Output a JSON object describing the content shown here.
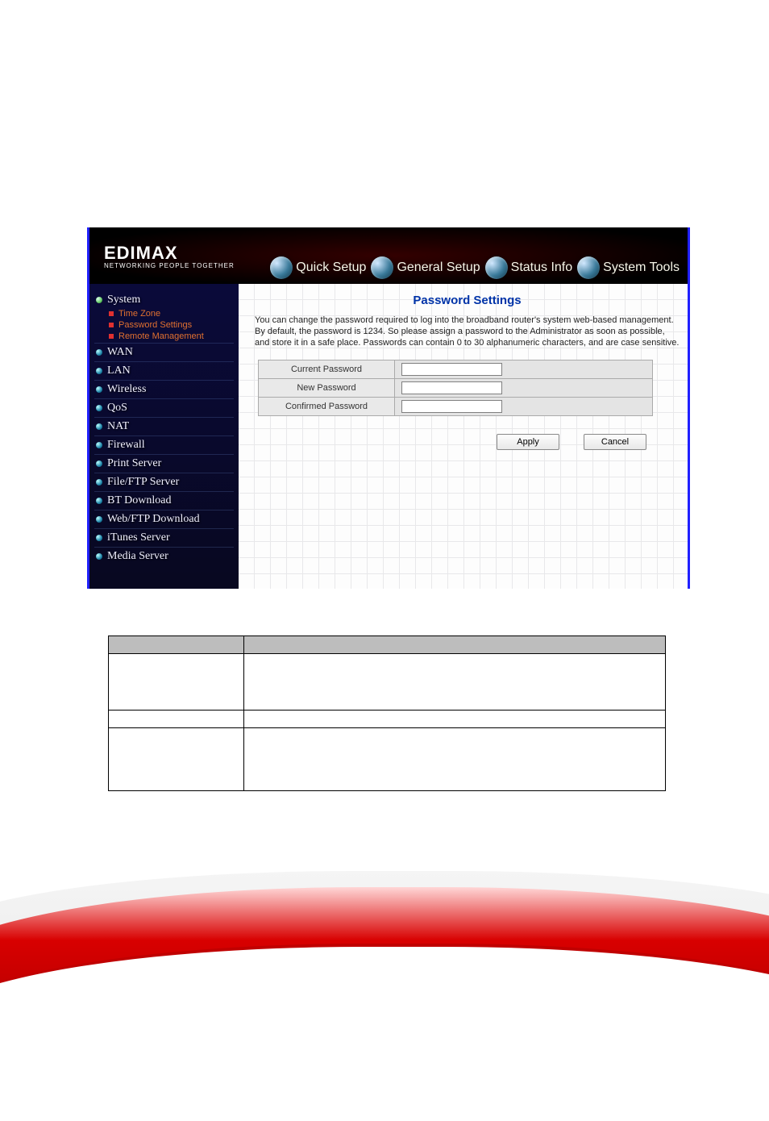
{
  "brand": {
    "name": "EDIMAX",
    "tagline": "NETWORKING PEOPLE TOGETHER"
  },
  "tabs": {
    "quick": "Quick Setup",
    "general": "General Setup",
    "status": "Status Info",
    "tools": "System Tools"
  },
  "sidebar": {
    "system": "System",
    "system_children": {
      "tz": "Time Zone",
      "pw": "Password Settings",
      "rm": "Remote Management"
    },
    "wan": "WAN",
    "lan": "LAN",
    "wireless": "Wireless",
    "qos": "QoS",
    "nat": "NAT",
    "firewall": "Firewall",
    "print": "Print Server",
    "fileftp": "File/FTP Server",
    "bt": "BT Download",
    "webftp": "Web/FTP Download",
    "itunes": "iTunes Server",
    "media": "Media Server"
  },
  "page": {
    "title": "Password Settings",
    "description": "You can change the password required to log into the broadband router's system web-based management. By default, the password is 1234. So please assign a password to the Administrator as soon as possible, and store it in a safe place. Passwords can contain 0 to 30 alphanumeric characters, and are case sensitive.",
    "fields": {
      "current": {
        "label": "Current Password",
        "value": ""
      },
      "new": {
        "label": "New Password",
        "value": ""
      },
      "confirm": {
        "label": "Confirmed Password",
        "value": ""
      }
    },
    "buttons": {
      "apply": "Apply",
      "cancel": "Cancel"
    }
  },
  "desc_table": {
    "header_left": "",
    "header_right": "",
    "rows": [
      {
        "param": "",
        "desc": ""
      },
      {
        "param": "",
        "desc": ""
      },
      {
        "param": "",
        "desc": ""
      }
    ]
  }
}
